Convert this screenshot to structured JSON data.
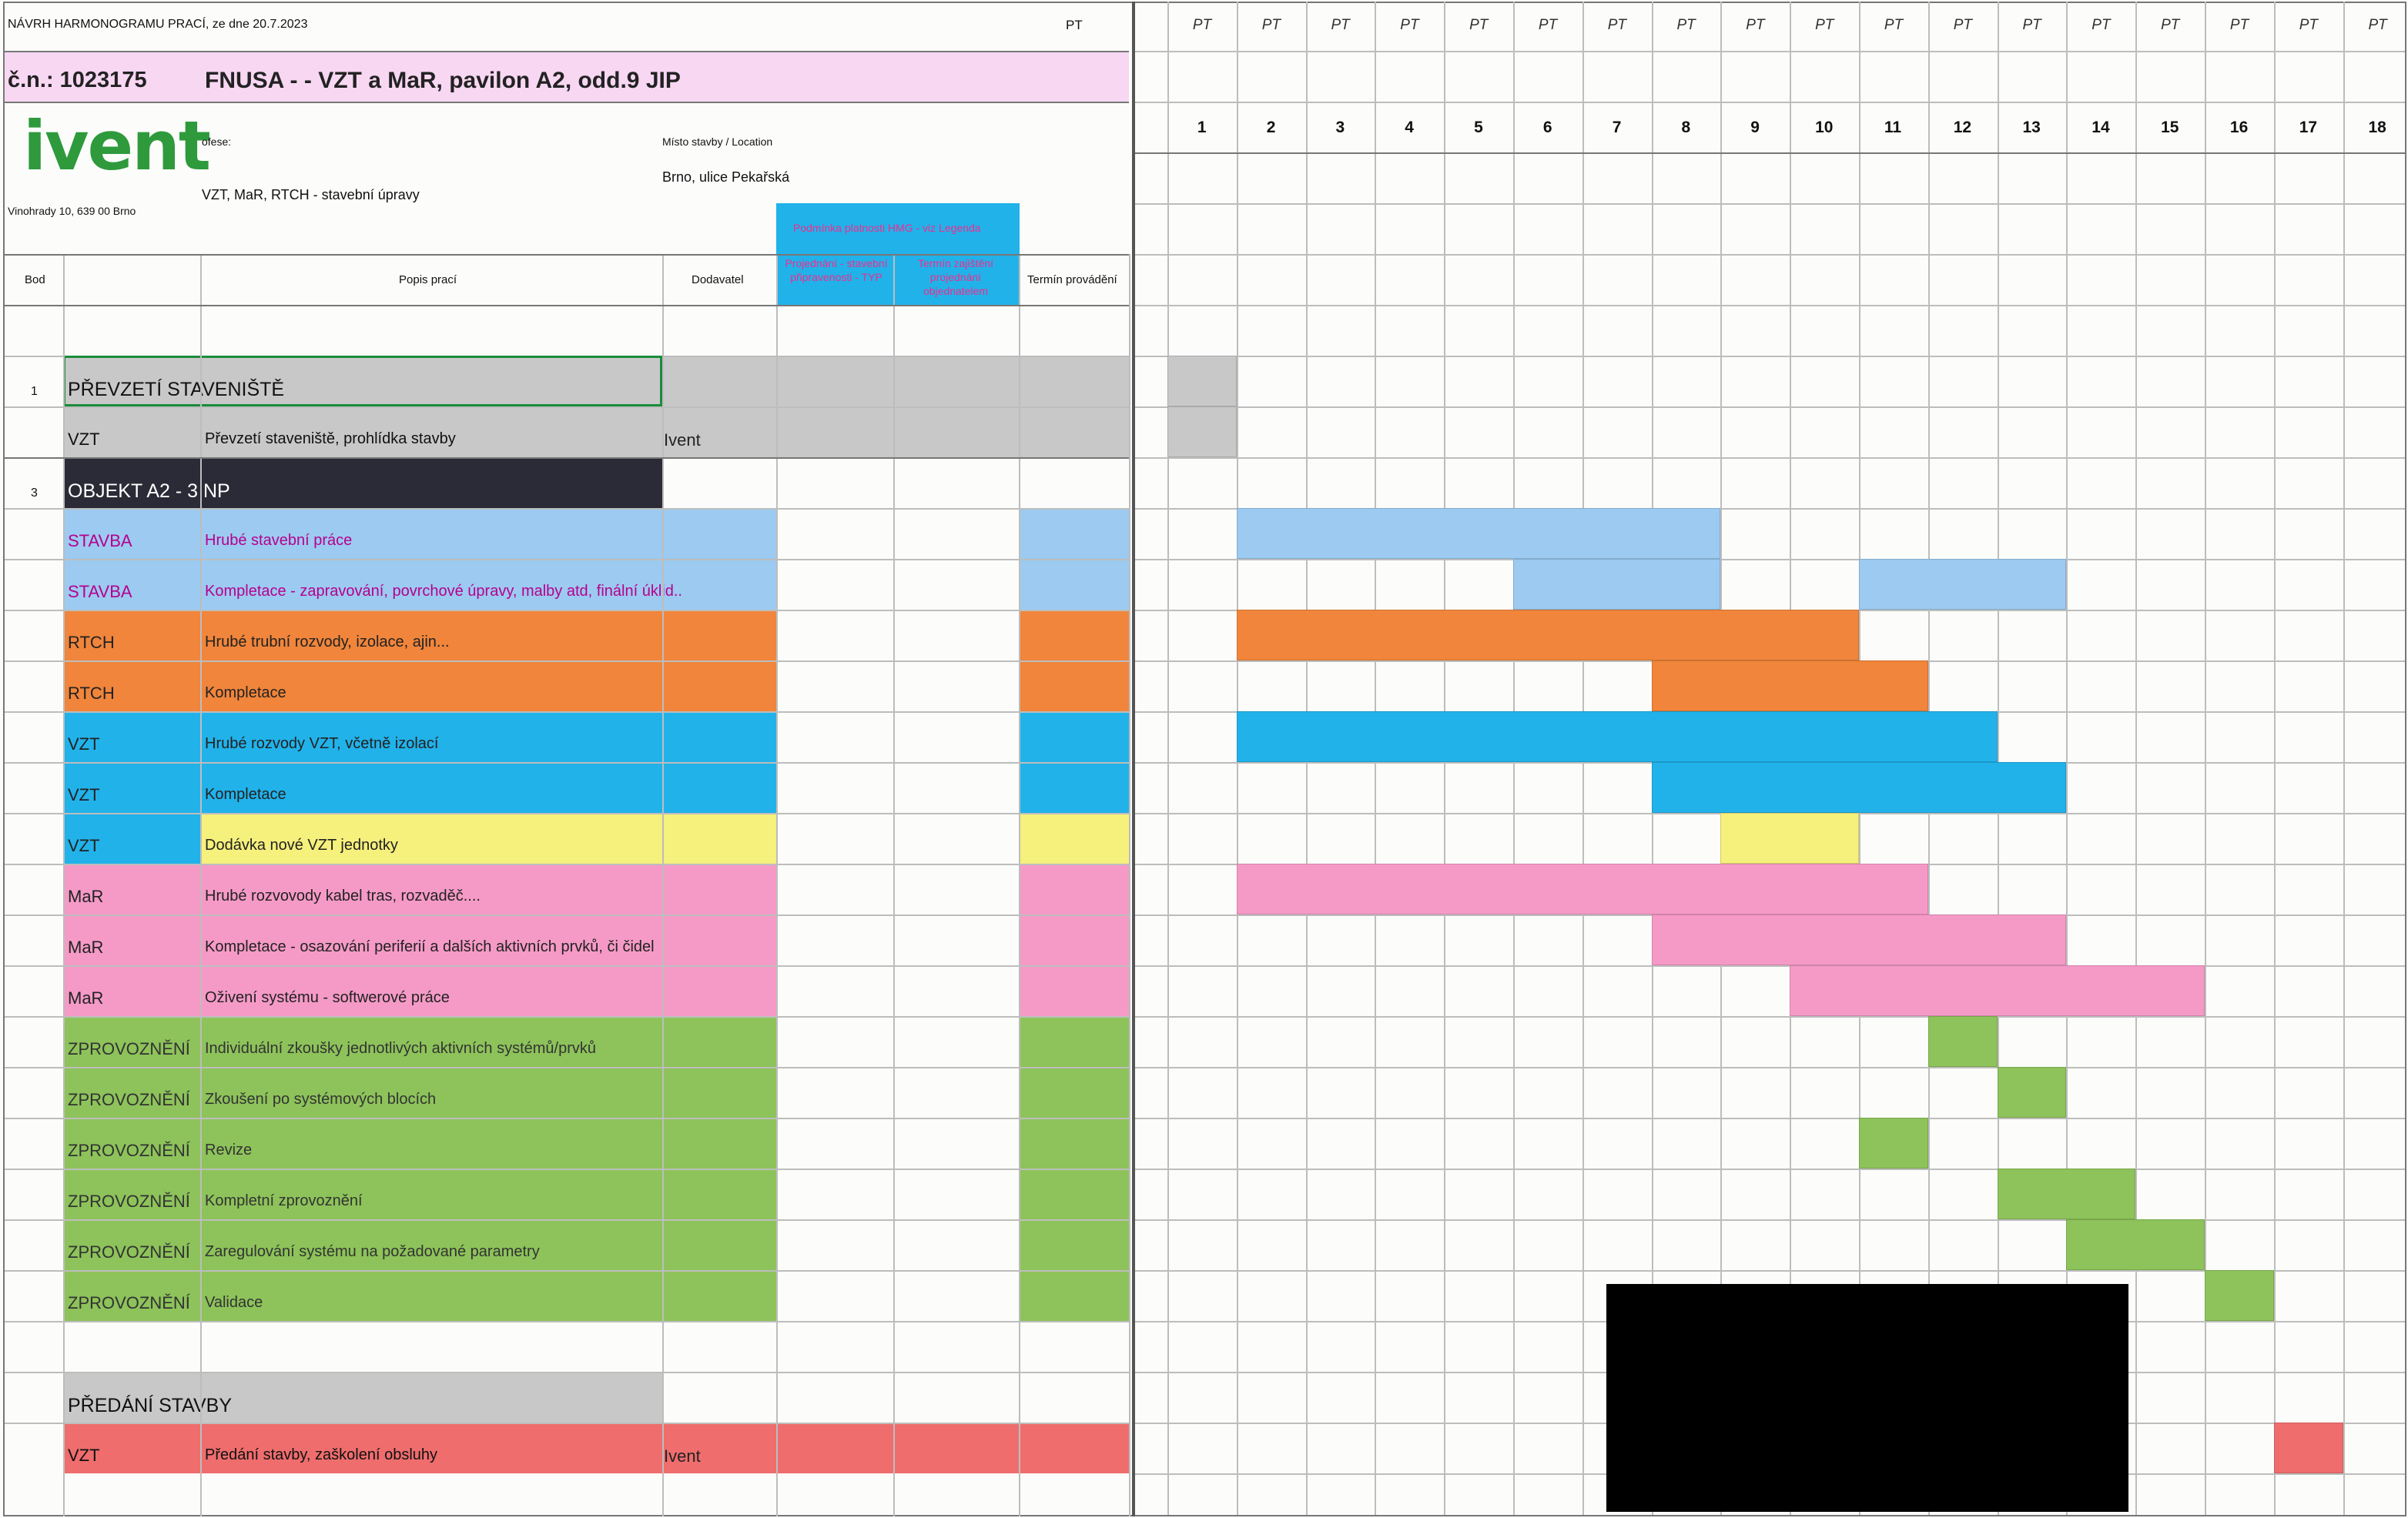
{
  "header": {
    "doc_title": "NÁVRH HARMONOGRAMU PRACÍ, ze dne 20.7.2023",
    "pt_label": "PT",
    "contract": "č.n.: 1023175",
    "project": "FNUSA - - VZT a MaR, pavilon A2, odd.9 JIP",
    "logo": "ivent",
    "profese_label": "ofese:",
    "profese_value": "VZT, MaR, RTCH - stavební úpravy",
    "address": "Vinohrady 10, 639 00 Brno",
    "site_label": "Místo stavby / Location",
    "site_value": "Brno, ulice Pekařská",
    "blue_header": "Podmínka platnosti HMG - viz Legenda",
    "col1_note": "Projednání - stavební připravenosti - TYP",
    "col2_note": "Termín zajištění projednání objednatelem"
  },
  "columns": {
    "bod": "Bod",
    "popis": "Popis prací",
    "dodavatel": "Dodavatel",
    "termin": "Termín provádění"
  },
  "timeline": {
    "pt": [
      "PT",
      "PT",
      "PT",
      "PT",
      "PT",
      "PT",
      "PT",
      "PT",
      "PT",
      "PT",
      "PT",
      "PT",
      "PT",
      "PT",
      "PT",
      "PT",
      "PT",
      "PT"
    ],
    "days": [
      "1",
      "2",
      "3",
      "4",
      "5",
      "6",
      "7",
      "8",
      "9",
      "10",
      "11",
      "12",
      "13",
      "14",
      "15",
      "16",
      "17",
      "18"
    ]
  },
  "rows": [
    {
      "bod": "",
      "code": "",
      "desc": "",
      "dodavatel": ""
    },
    {
      "bod": "1",
      "code": "PŘEVZETÍ STAVENIŠTĚ",
      "desc": "",
      "dodavatel": ""
    },
    {
      "bod": "",
      "code": "VZT",
      "desc": "Převzetí staveniště, prohlídka stavby",
      "dodavatel": "Ivent"
    },
    {
      "bod": "3",
      "code": "OBJEKT A2 - 3 NP",
      "desc": "",
      "dodavatel": ""
    },
    {
      "bod": "",
      "code": "STAVBA",
      "desc": "Hrubé stavební práce",
      "dodavatel": ""
    },
    {
      "bod": "",
      "code": "STAVBA",
      "desc": "Kompletace - zapravování, povrchové úpravy, malby atd, finální úklid..",
      "dodavatel": ""
    },
    {
      "bod": "",
      "code": "RTCH",
      "desc": "Hrubé trubní rozvody, izolace, ajin...",
      "dodavatel": ""
    },
    {
      "bod": "",
      "code": "RTCH",
      "desc": "Kompletace",
      "dodavatel": ""
    },
    {
      "bod": "",
      "code": "VZT",
      "desc": "Hrubé rozvody VZT, včetně izolací",
      "dodavatel": ""
    },
    {
      "bod": "",
      "code": "VZT",
      "desc": "Kompletace",
      "dodavatel": ""
    },
    {
      "bod": "",
      "code": "VZT",
      "desc": "Dodávka nové VZT jednotky",
      "dodavatel": ""
    },
    {
      "bod": "",
      "code": "MaR",
      "desc": "Hrubé rozvovody kabel tras, rozvaděč....",
      "dodavatel": ""
    },
    {
      "bod": "",
      "code": "MaR",
      "desc": "Kompletace - osazování periferií a dalších aktivních prvků, či čidel",
      "dodavatel": ""
    },
    {
      "bod": "",
      "code": "MaR",
      "desc": "Oživení systému - softwerové práce",
      "dodavatel": ""
    },
    {
      "bod": "",
      "code": "ZPROVOZNĚNÍ",
      "desc": "Individuální zkoušky jednotlivých aktivních systémů/prvků",
      "dodavatel": ""
    },
    {
      "bod": "",
      "code": "ZPROVOZNĚNÍ",
      "desc": "Zkoušení po systémových blocích",
      "dodavatel": ""
    },
    {
      "bod": "",
      "code": "ZPROVOZNĚNÍ",
      "desc": "Revize",
      "dodavatel": ""
    },
    {
      "bod": "",
      "code": "ZPROVOZNĚNÍ",
      "desc": "Kompletní zprovoznění",
      "dodavatel": ""
    },
    {
      "bod": "",
      "code": "ZPROVOZNĚNÍ",
      "desc": "Zaregulování systému na požadované parametry",
      "dodavatel": ""
    },
    {
      "bod": "",
      "code": "ZPROVOZNĚNÍ",
      "desc": "Validace",
      "dodavatel": ""
    },
    {
      "bod": "",
      "code": "",
      "desc": "",
      "dodavatel": ""
    },
    {
      "bod": "",
      "code": "PŘEDÁNÍ STAVBY",
      "desc": "",
      "dodavatel": ""
    },
    {
      "bod": "",
      "code": "VZT",
      "desc": "Předání stavby, zaškolení obsluhy",
      "dodavatel": "Ivent"
    }
  ],
  "gantt": [
    {
      "row": 1,
      "start": 1,
      "end": 1,
      "color": "#c8c8c8"
    },
    {
      "row": 2,
      "start": 1,
      "end": 1,
      "color": "#c8c8c8"
    },
    {
      "row": 4,
      "start": 2,
      "end": 8,
      "color": "#9ccaf0"
    },
    {
      "row": 5,
      "start": 6,
      "end": 8,
      "color": "#9ccaf0"
    },
    {
      "row": 5,
      "start": 11,
      "end": 13,
      "color": "#9ccaf0"
    },
    {
      "row": 6,
      "start": 2,
      "end": 10,
      "color": "#f0853b"
    },
    {
      "row": 7,
      "start": 8,
      "end": 11,
      "color": "#f0853b"
    },
    {
      "row": 8,
      "start": 2,
      "end": 12,
      "color": "#21b2ea"
    },
    {
      "row": 9,
      "start": 8,
      "end": 13,
      "color": "#21b2ea"
    },
    {
      "row": 10,
      "start": 9,
      "end": 10,
      "color": "#f6f07c"
    },
    {
      "row": 11,
      "start": 2,
      "end": 11,
      "color": "#f59ac7"
    },
    {
      "row": 12,
      "start": 8,
      "end": 13,
      "color": "#f59ac7"
    },
    {
      "row": 13,
      "start": 10,
      "end": 15,
      "color": "#f59ac7"
    },
    {
      "row": 14,
      "start": 12,
      "end": 12,
      "color": "#8dc35a"
    },
    {
      "row": 15,
      "start": 13,
      "end": 13,
      "color": "#8dc35a"
    },
    {
      "row": 16,
      "start": 11,
      "end": 11,
      "color": "#8dc35a"
    },
    {
      "row": 17,
      "start": 13,
      "end": 14,
      "color": "#8dc35a"
    },
    {
      "row": 18,
      "start": 14,
      "end": 15,
      "color": "#8dc35a"
    },
    {
      "row": 19,
      "start": 16,
      "end": 16,
      "color": "#8dc35a"
    },
    {
      "row": 22,
      "start": 17,
      "end": 17,
      "color": "#ef6d6d"
    }
  ],
  "colors": {
    "stavba": "#9ccaf0",
    "rtch": "#f0853b",
    "vzt": "#21b2ea",
    "vzt_yellow": "#f6f07c",
    "mar": "#f59ac7",
    "zprov": "#8dc35a",
    "gray": "#c8c8c8",
    "dark": "#2a2b36",
    "red": "#ef6d6d",
    "pink_header": "#f8d7f3",
    "green_logo": "#2e9a3c"
  }
}
